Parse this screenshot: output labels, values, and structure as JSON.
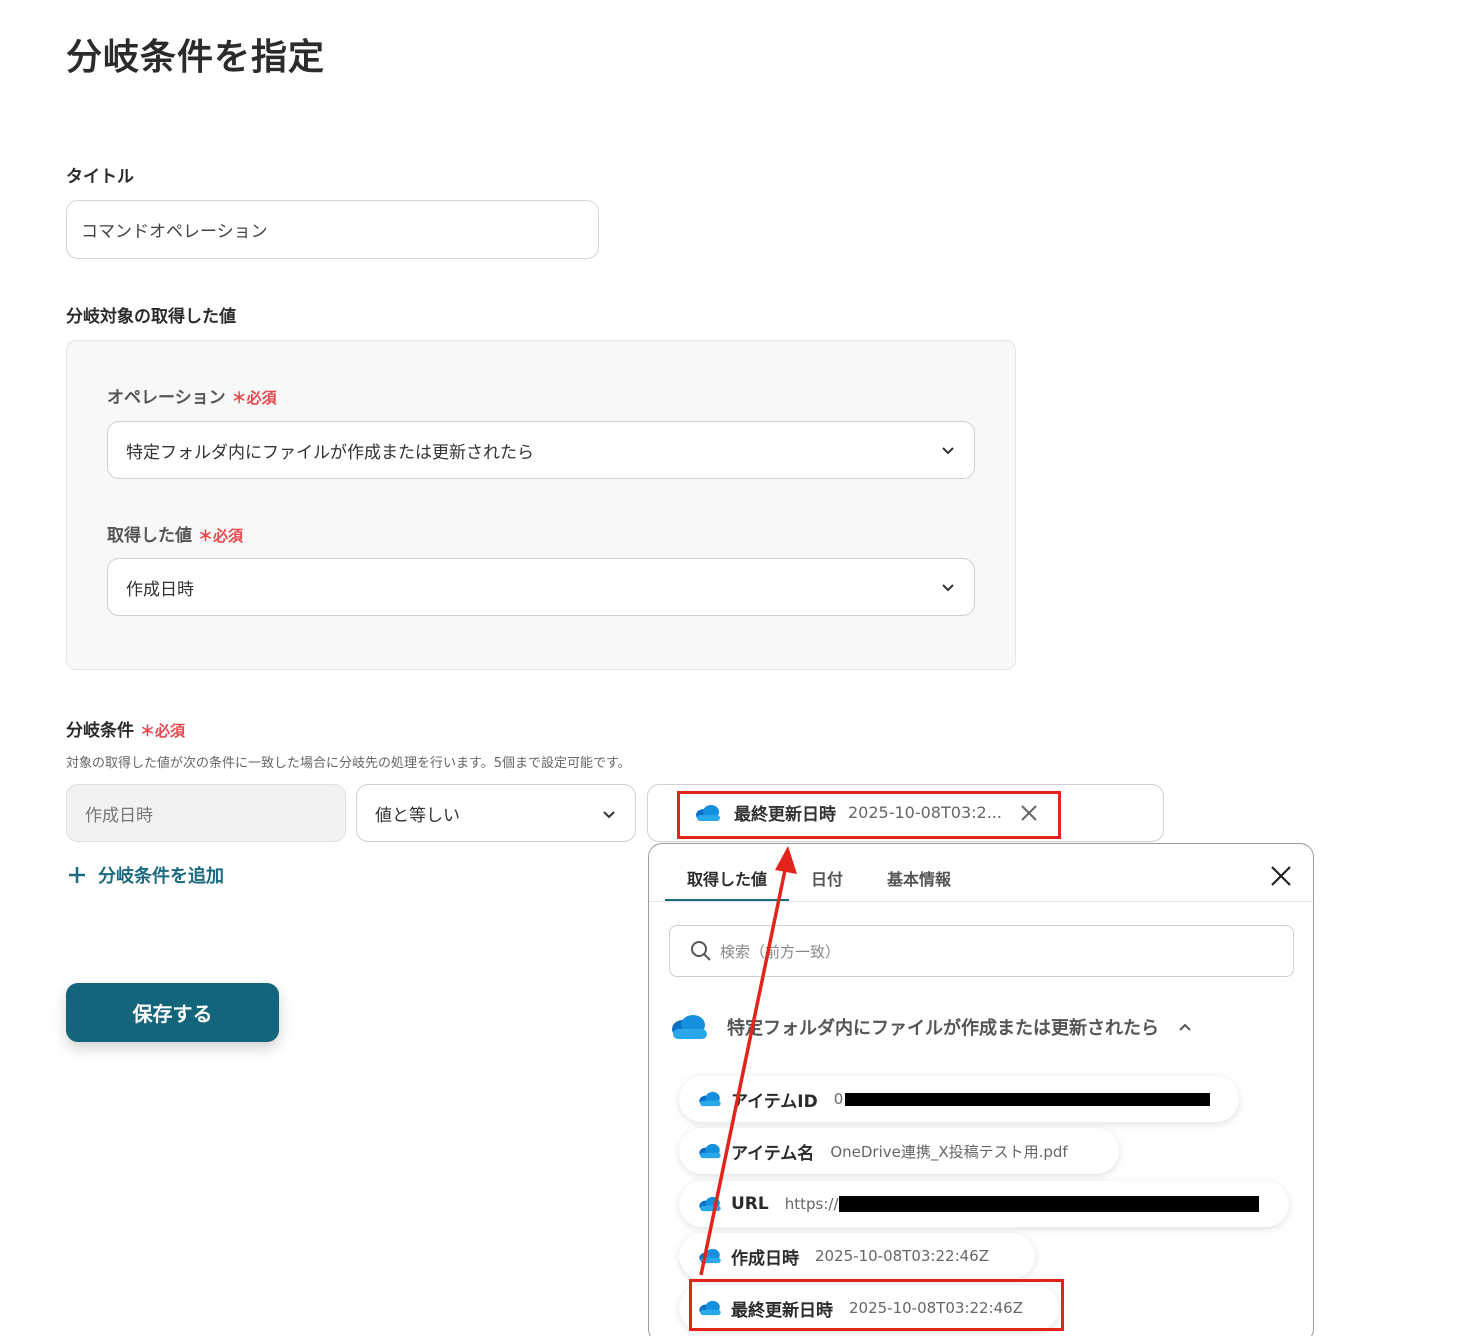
{
  "page": {
    "title": "分岐条件を指定"
  },
  "title_field": {
    "label": "タイトル",
    "value": "コマンドオペレーション"
  },
  "target_section": {
    "label": "分岐対象の取得した値",
    "operation": {
      "label": "オペレーション",
      "required": "＊必須",
      "value": "特定フォルダ内にファイルが作成または更新されたら"
    },
    "value_field": {
      "label": "取得した値",
      "required": "＊必須",
      "value": "作成日時"
    }
  },
  "condition": {
    "label": "分岐条件",
    "required": "＊必須",
    "help": "対象の取得した値が次の条件に一致した場合に分岐先の処理を行います。5個まで設定可能です。",
    "field_value": "作成日時",
    "operator": "値と等しい",
    "chip": {
      "icon": "onedrive-cloud-icon",
      "label": "最終更新日時",
      "value": "2025-10-08T03:2..."
    },
    "add_label": "分岐条件を追加"
  },
  "save_label": "保存する",
  "dropdown": {
    "tabs": [
      "取得した値",
      "日付",
      "基本情報"
    ],
    "active_tab": "取得した値",
    "search_placeholder": "検索（前方一致）",
    "group_title": "特定フォルダ内にファイルが作成または更新されたら",
    "items": [
      {
        "label": "アイテムID",
        "value": "0",
        "redacted": true
      },
      {
        "label": "アイテム名",
        "value": "OneDrive連携_X投稿テスト用.pdf",
        "redacted": false
      },
      {
        "label": "URL",
        "value": "https://",
        "redacted": true
      },
      {
        "label": "作成日時",
        "value": "2025-10-08T03:22:46Z",
        "redacted": false
      },
      {
        "label": "最終更新日時",
        "value": "2025-10-08T03:22:46Z",
        "redacted": false
      }
    ]
  },
  "colors": {
    "accent": "#12657b",
    "required": "#e5484d",
    "annotation": "#e3241b",
    "onedrive": "#1a8fd8"
  }
}
